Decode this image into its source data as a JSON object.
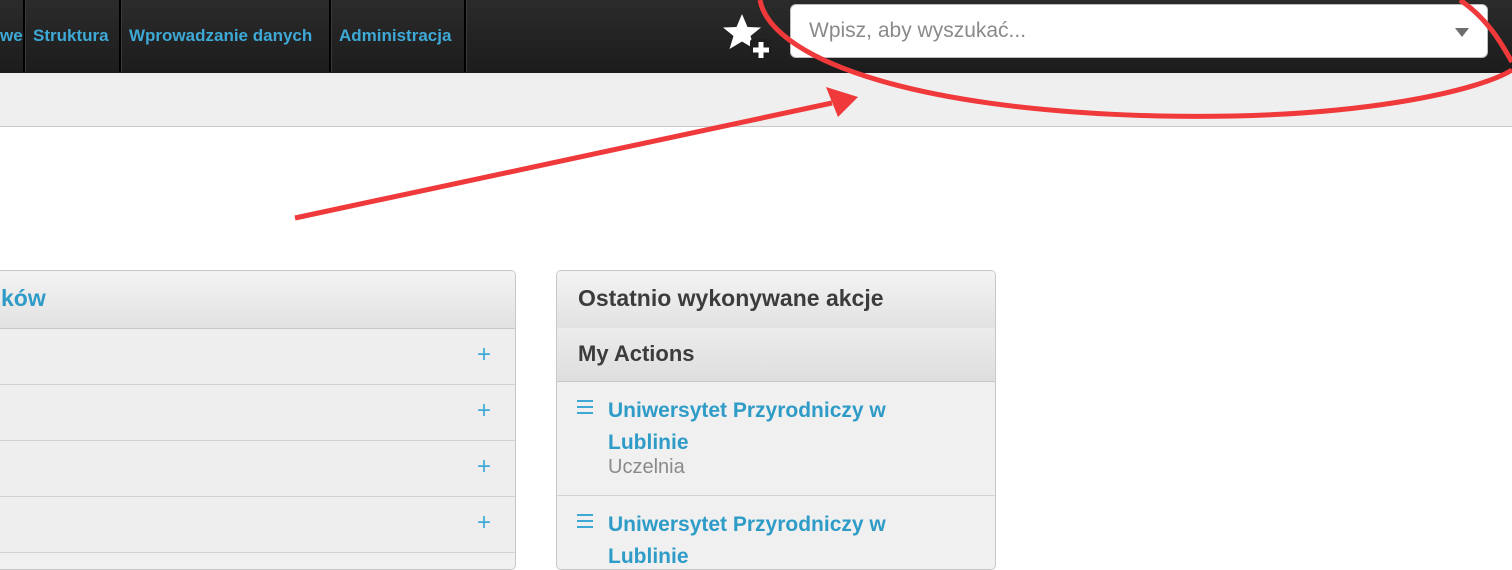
{
  "nav": {
    "partial_item": "we",
    "items": [
      "Struktura",
      "Wprowadzanie danych",
      "Administracja"
    ]
  },
  "search": {
    "placeholder": "Wpisz, aby wyszukać..."
  },
  "left_panel": {
    "title_partial": "ków"
  },
  "right_panel": {
    "title": "Ostatnio wykonywane akcje",
    "subtitle": "My Actions",
    "actions": [
      {
        "title": "Uniwersytet Przyrodniczy w Lublinie",
        "subtitle": "Uczelnia"
      },
      {
        "title": "Uniwersytet Przyrodniczy w Lublinie"
      }
    ]
  },
  "colors": {
    "accent": "#3ea9d6",
    "topbar": "#222222",
    "annotation": "#f0393a"
  },
  "icons": {
    "favorite_add": "star-plus-icon",
    "list": "menu-icon",
    "expand": "plus-icon",
    "dropdown": "chevron-down-icon"
  }
}
